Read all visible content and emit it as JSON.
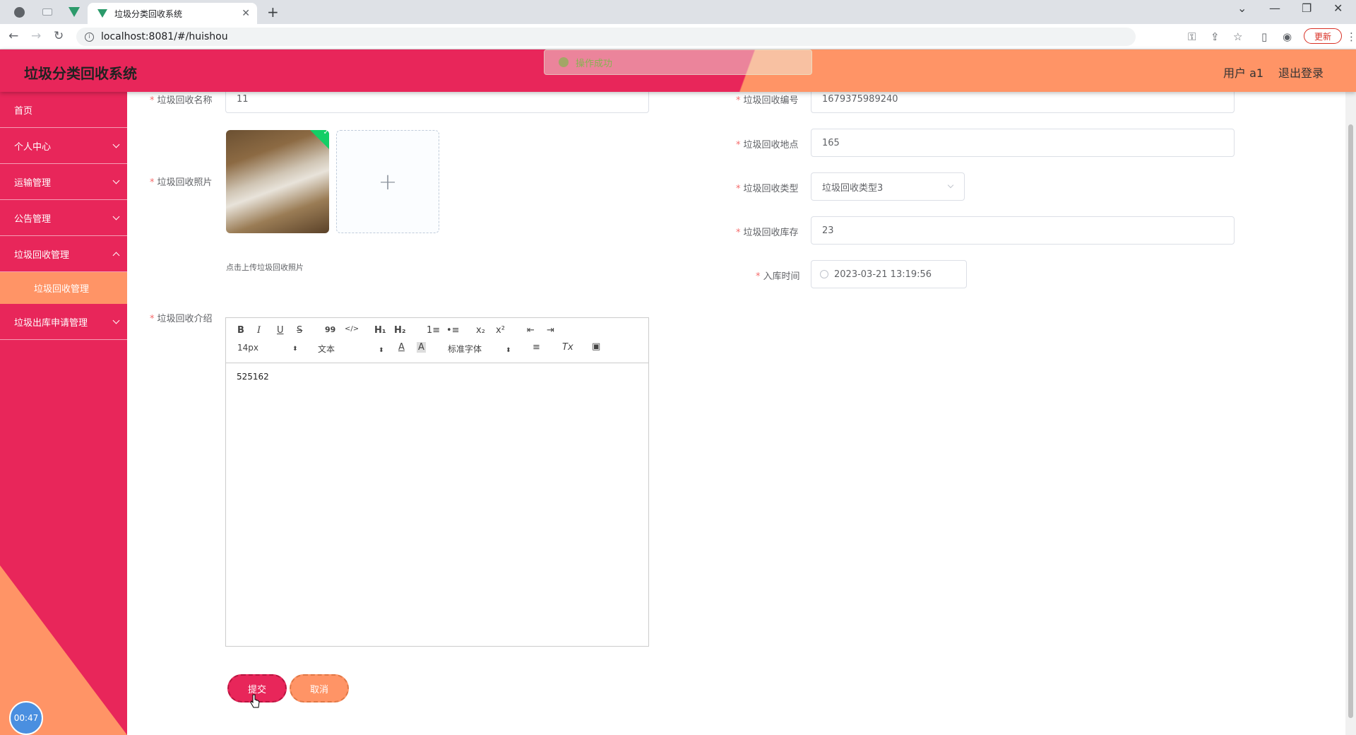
{
  "browser": {
    "tab_title": "垃圾分类回收系统",
    "url": "localhost:8081/#/huishou",
    "update_label": "更新"
  },
  "header": {
    "app_title": "垃圾分类回收系统",
    "user_label": "用户 a1",
    "logout_label": "退出登录",
    "toast_message": "操作成功"
  },
  "sidebar": {
    "items": [
      {
        "label": "首页"
      },
      {
        "label": "个人中心"
      },
      {
        "label": "运输管理"
      },
      {
        "label": "公告管理"
      },
      {
        "label": "垃圾回收管理"
      },
      {
        "label": "垃圾回收管理"
      },
      {
        "label": "垃圾出库申请管理"
      }
    ],
    "timer": "00:47"
  },
  "form": {
    "name_label": "垃圾回收名称",
    "name_value": "11",
    "code_label": "垃圾回收编号",
    "code_value": "1679375989240",
    "photo_label": "垃圾回收照片",
    "photo_tip": "点击上传垃圾回收照片",
    "location_label": "垃圾回收地点",
    "location_value": "165",
    "type_label": "垃圾回收类型",
    "type_value": "垃圾回收类型3",
    "stock_label": "垃圾回收库存",
    "stock_value": "23",
    "time_label": "入库时间",
    "time_value": "2023-03-21 13:19:56",
    "intro_label": "垃圾回收介绍",
    "intro_content": "525162",
    "submit_label": "提交",
    "cancel_label": "取消"
  },
  "editor_toolbar": {
    "bold": "B",
    "italic": "I",
    "underline": "U",
    "strike": "S",
    "quote": "99",
    "code": "</>",
    "h1": "H₁",
    "h2": "H₂",
    "ordered": "1≡",
    "bullet": "•≡",
    "sub": "x₂",
    "sup": "x²",
    "outdent": "⇤",
    "indent": "⇥",
    "size": "14px",
    "header": "文本",
    "font": "标准字体",
    "color": "A",
    "bg": "A",
    "align": "≡",
    "clean": "Tx",
    "image": "▣"
  },
  "colors": {
    "primary": "#e8265a",
    "secondary": "#ff9466",
    "success": "#67c23a"
  }
}
